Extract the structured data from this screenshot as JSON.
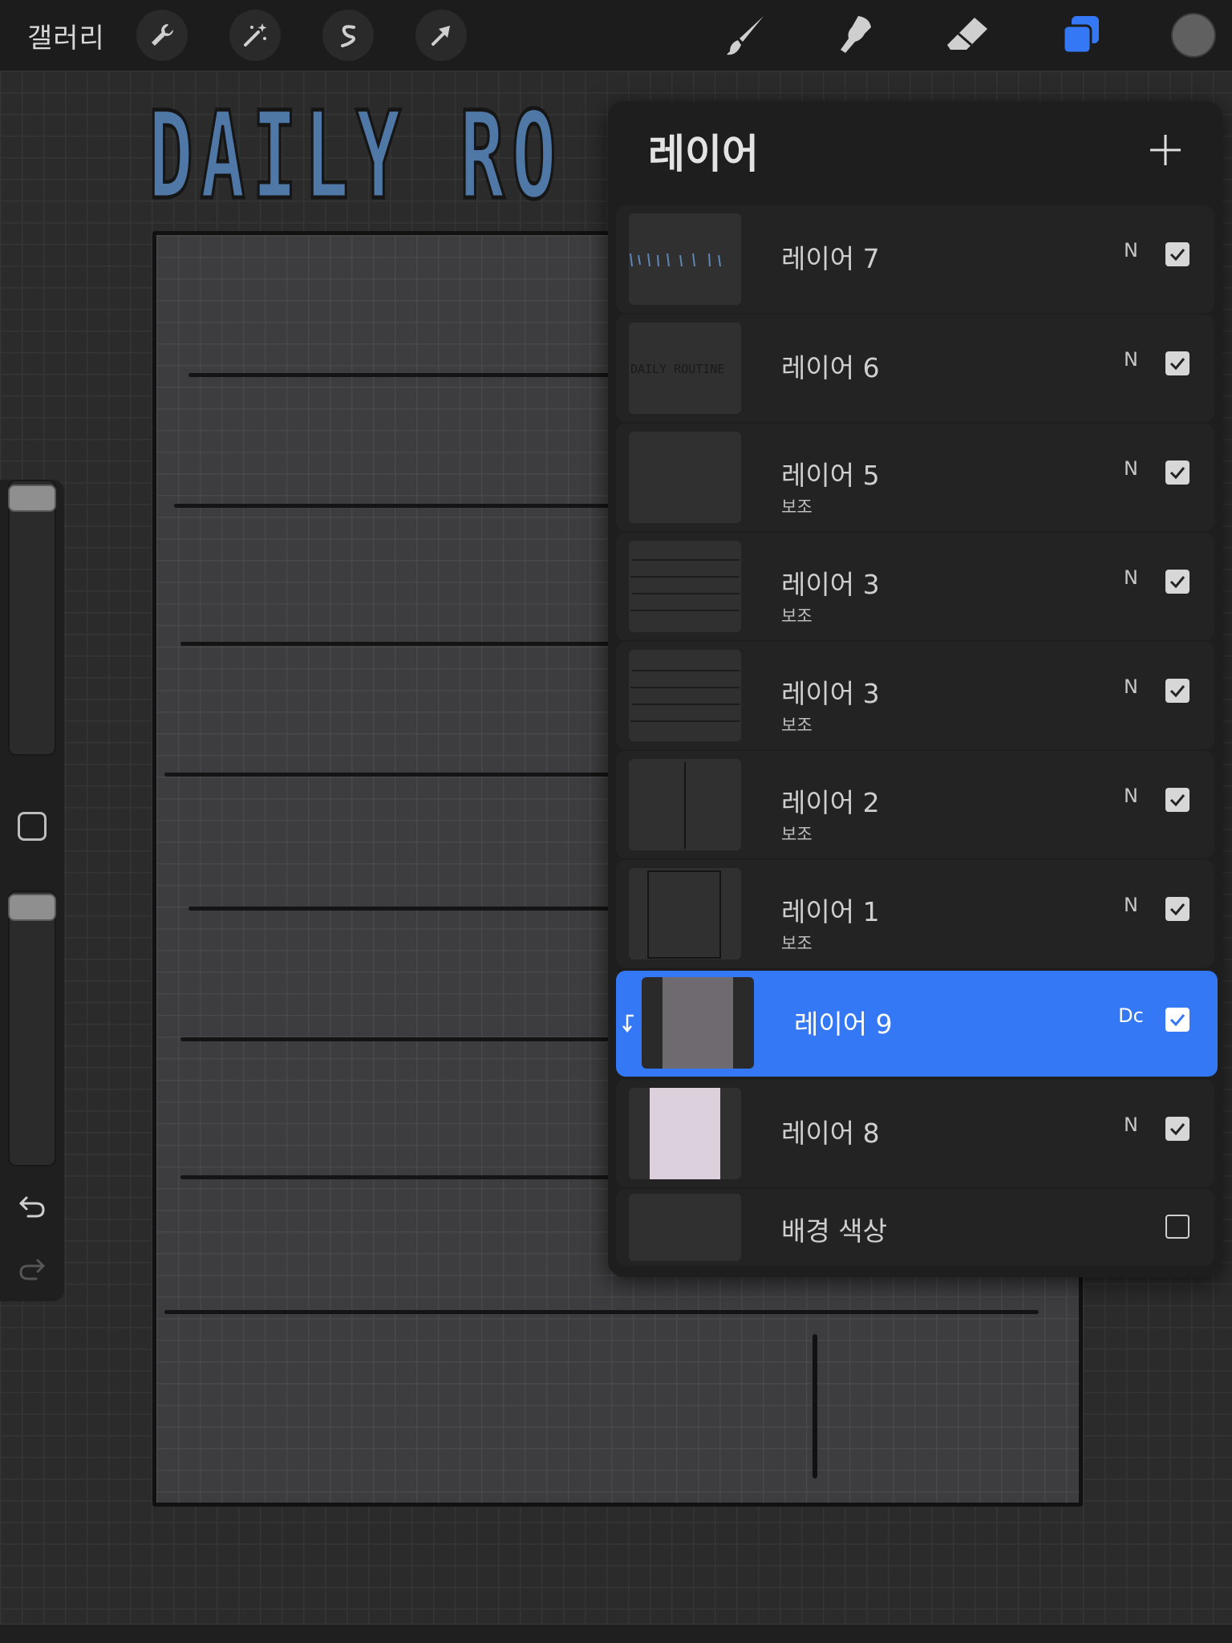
{
  "top_bar": {
    "gallery_label": "갤러리",
    "tools_left": [
      "wrench-icon",
      "magic-wand-icon",
      "selection-icon",
      "transform-arrow-icon"
    ],
    "tools_right": [
      "brush-icon",
      "smudge-icon",
      "eraser-icon",
      "layers-icon"
    ],
    "active_tool": "layers-icon",
    "accent_color": "#3478f6",
    "current_color": "#606060"
  },
  "canvas": {
    "title_art": "DAILY RO"
  },
  "sidebar": {
    "icons": [
      "brush-size-slider",
      "modify-button",
      "opacity-slider",
      "undo-icon",
      "redo-icon"
    ]
  },
  "layers_panel": {
    "title": "레이어",
    "add_button_icon": "plus-icon",
    "layers": [
      {
        "name": "레이어 7",
        "sub": "",
        "blend": "N",
        "visible": true,
        "selected": false,
        "thumb": "text-strokes"
      },
      {
        "name": "레이어 6",
        "sub": "",
        "blend": "N",
        "visible": true,
        "selected": false,
        "thumb": "daily-routine-text"
      },
      {
        "name": "레이어 5",
        "sub": "보조",
        "blend": "N",
        "visible": true,
        "selected": false,
        "thumb": "empty"
      },
      {
        "name": "레이어 3",
        "sub": "보조",
        "blend": "N",
        "visible": true,
        "selected": false,
        "thumb": "horizontal-lines"
      },
      {
        "name": "레이어 3",
        "sub": "보조",
        "blend": "N",
        "visible": true,
        "selected": false,
        "thumb": "horizontal-lines"
      },
      {
        "name": "레이어 2",
        "sub": "보조",
        "blend": "N",
        "visible": true,
        "selected": false,
        "thumb": "vertical-line"
      },
      {
        "name": "레이어 1",
        "sub": "보조",
        "blend": "N",
        "visible": true,
        "selected": false,
        "thumb": "frame"
      },
      {
        "name": "레이어 9",
        "sub": "",
        "blend": "Dc",
        "visible": true,
        "selected": true,
        "clipping_mask": true,
        "thumb": "paper-texture"
      },
      {
        "name": "레이어 8",
        "sub": "",
        "blend": "N",
        "visible": true,
        "selected": false,
        "thumb": "pink-fill"
      },
      {
        "name": "배경 색상",
        "sub": "",
        "blend": "",
        "visible": false,
        "selected": false,
        "thumb": "dark-fill"
      }
    ]
  }
}
